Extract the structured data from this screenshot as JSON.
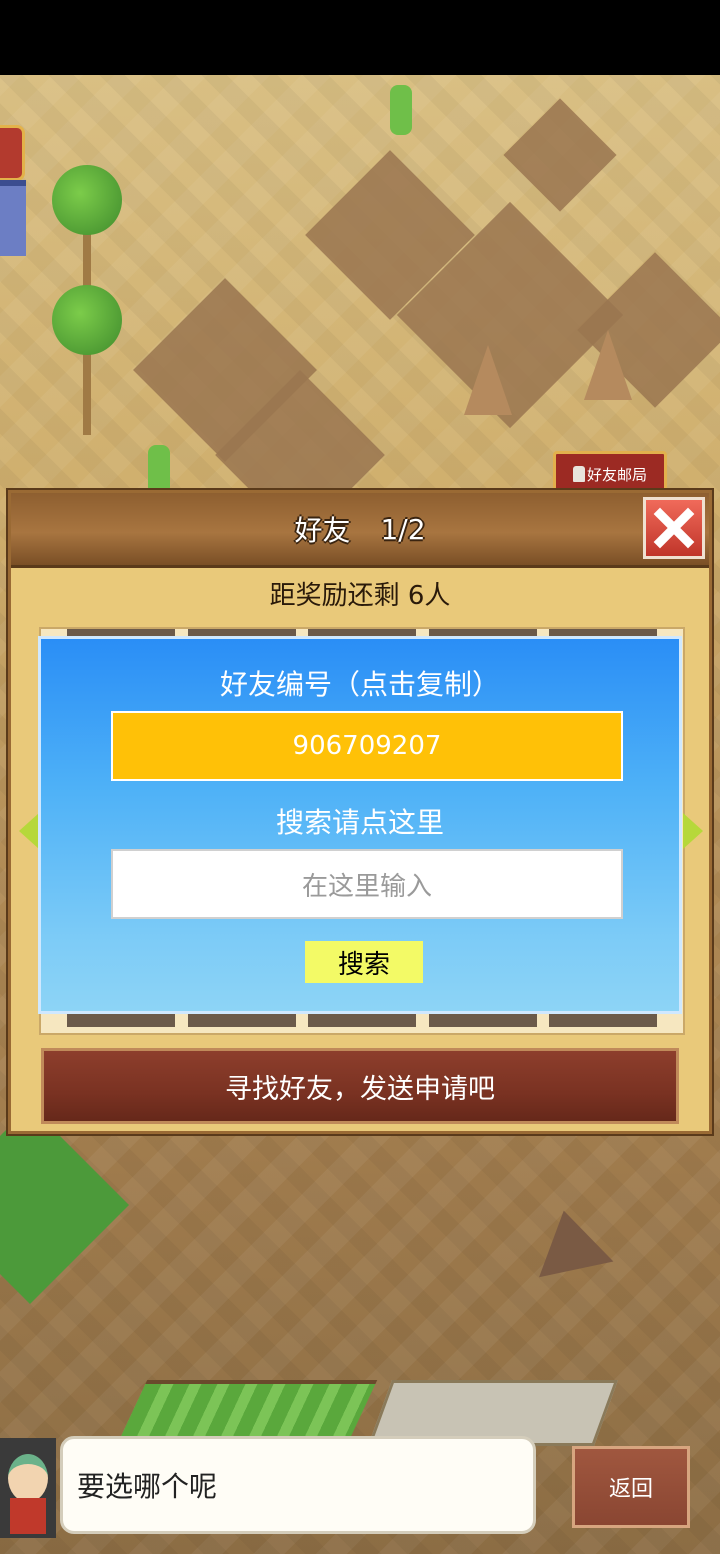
{
  "map": {
    "mail_sign_label": "好友邮局"
  },
  "friends_panel": {
    "title": "好友",
    "page": "1/2",
    "reward_text": "距奖励还剩 6人",
    "find_friends_label": "寻找好友，发送申请吧"
  },
  "id_dialog": {
    "friend_id_label": "好友编号（点击复制）",
    "friend_id_value": "906709207",
    "search_label": "搜索请点这里",
    "search_placeholder": "在这里输入",
    "search_button": "搜索"
  },
  "bottom_bar": {
    "speech_text": "要选哪个呢",
    "back_label": "返回"
  },
  "colors": {
    "dialog_blue": "#2a8ef6",
    "id_box_yellow": "#ffc107",
    "search_button_yellow": "#f3fa66",
    "close_red": "#e04a3c"
  }
}
